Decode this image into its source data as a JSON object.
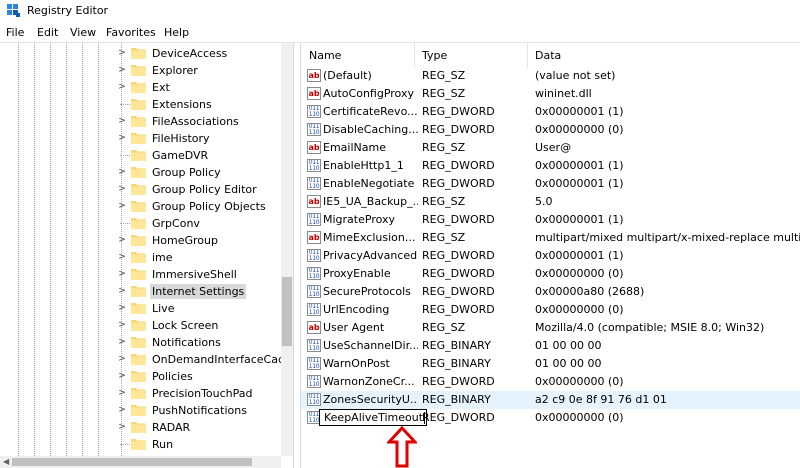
{
  "window": {
    "title": "Registry Editor"
  },
  "menu": [
    "File",
    "Edit",
    "View",
    "Favorites",
    "Help"
  ],
  "tree": {
    "items": [
      {
        "label": "DeviceAccess",
        "expandable": true
      },
      {
        "label": "Explorer",
        "expandable": true
      },
      {
        "label": "Ext",
        "expandable": true
      },
      {
        "label": "Extensions",
        "expandable": false
      },
      {
        "label": "FileAssociations",
        "expandable": true
      },
      {
        "label": "FileHistory",
        "expandable": true
      },
      {
        "label": "GameDVR",
        "expandable": false
      },
      {
        "label": "Group Policy",
        "expandable": true
      },
      {
        "label": "Group Policy Editor",
        "expandable": true
      },
      {
        "label": "Group Policy Objects",
        "expandable": true
      },
      {
        "label": "GrpConv",
        "expandable": false
      },
      {
        "label": "HomeGroup",
        "expandable": true
      },
      {
        "label": "ime",
        "expandable": true
      },
      {
        "label": "ImmersiveShell",
        "expandable": true
      },
      {
        "label": "Internet Settings",
        "expandable": true,
        "selected": true
      },
      {
        "label": "Live",
        "expandable": true
      },
      {
        "label": "Lock Screen",
        "expandable": true
      },
      {
        "label": "Notifications",
        "expandable": true
      },
      {
        "label": "OnDemandInterfaceCach",
        "expandable": true
      },
      {
        "label": "Policies",
        "expandable": true
      },
      {
        "label": "PrecisionTouchPad",
        "expandable": true
      },
      {
        "label": "PushNotifications",
        "expandable": true
      },
      {
        "label": "RADAR",
        "expandable": true
      },
      {
        "label": "Run",
        "expandable": false
      }
    ]
  },
  "list": {
    "headers": {
      "name": "Name",
      "type": "Type",
      "data": "Data"
    },
    "rows": [
      {
        "name": "(Default)",
        "type": "REG_SZ",
        "data": "(value not set)",
        "icon": "string-value-icon"
      },
      {
        "name": "AutoConfigProxy",
        "type": "REG_SZ",
        "data": "wininet.dll",
        "icon": "string-value-icon"
      },
      {
        "name": "CertificateRevo...",
        "type": "REG_DWORD",
        "data": "0x00000001 (1)",
        "icon": "binary-value-icon"
      },
      {
        "name": "DisableCaching...",
        "type": "REG_DWORD",
        "data": "0x00000000 (0)",
        "icon": "binary-value-icon"
      },
      {
        "name": "EmailName",
        "type": "REG_SZ",
        "data": "User@",
        "icon": "string-value-icon"
      },
      {
        "name": "EnableHttp1_1",
        "type": "REG_DWORD",
        "data": "0x00000001 (1)",
        "icon": "binary-value-icon"
      },
      {
        "name": "EnableNegotiate",
        "type": "REG_DWORD",
        "data": "0x00000001 (1)",
        "icon": "binary-value-icon"
      },
      {
        "name": "IE5_UA_Backup_...",
        "type": "REG_SZ",
        "data": "5.0",
        "icon": "string-value-icon"
      },
      {
        "name": "MigrateProxy",
        "type": "REG_DWORD",
        "data": "0x00000001 (1)",
        "icon": "binary-value-icon"
      },
      {
        "name": "MimeExclusion...",
        "type": "REG_SZ",
        "data": "multipart/mixed multipart/x-mixed-replace multi...",
        "icon": "string-value-icon"
      },
      {
        "name": "PrivacyAdvanced",
        "type": "REG_DWORD",
        "data": "0x00000001 (1)",
        "icon": "binary-value-icon"
      },
      {
        "name": "ProxyEnable",
        "type": "REG_DWORD",
        "data": "0x00000000 (0)",
        "icon": "binary-value-icon"
      },
      {
        "name": "SecureProtocols",
        "type": "REG_DWORD",
        "data": "0x00000a80 (2688)",
        "icon": "binary-value-icon"
      },
      {
        "name": "UrlEncoding",
        "type": "REG_DWORD",
        "data": "0x00000000 (0)",
        "icon": "binary-value-icon"
      },
      {
        "name": "User Agent",
        "type": "REG_SZ",
        "data": "Mozilla/4.0 (compatible; MSIE 8.0; Win32)",
        "icon": "string-value-icon"
      },
      {
        "name": "UseSchannelDir...",
        "type": "REG_BINARY",
        "data": "01 00 00 00",
        "icon": "binary-value-icon"
      },
      {
        "name": "WarnOnPost",
        "type": "REG_BINARY",
        "data": "01 00 00 00",
        "icon": "binary-value-icon"
      },
      {
        "name": "WarnonZoneCr...",
        "type": "REG_DWORD",
        "data": "0x00000000 (0)",
        "icon": "binary-value-icon"
      },
      {
        "name": "ZonesSecurityU...",
        "type": "REG_BINARY",
        "data": "a2 c9 0e 8f 91 76 d1 01",
        "icon": "binary-value-icon",
        "hover": true
      },
      {
        "name": "KeepAliveTimeout",
        "type": "REG_DWORD",
        "data": "0x00000000 (0)",
        "icon": "binary-value-icon",
        "editing": true
      }
    ]
  },
  "colors": {
    "selection": "#d9d9d9",
    "hover": "#e5f3ff",
    "annotation_arrow": "#e00000",
    "string_icon": "#c00000",
    "binary_icon": "#1b4fb3"
  }
}
